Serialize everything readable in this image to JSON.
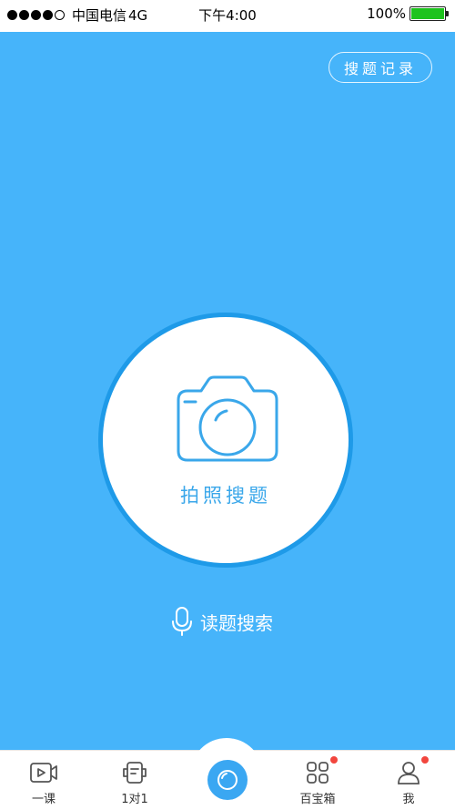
{
  "status_bar": {
    "carrier": "中国电信",
    "network": "4G",
    "time": "下午4:00",
    "battery": "100%",
    "battery_color": "#1ec31e"
  },
  "header": {
    "history_label": "搜题记录"
  },
  "capture": {
    "label": "拍照搜题",
    "icon": "camera-icon"
  },
  "voice": {
    "label": "读题搜索",
    "icon": "microphone-icon"
  },
  "tabs": [
    {
      "label": "一课",
      "icon": "video-lesson-icon",
      "badge": false
    },
    {
      "label": "1对1",
      "icon": "tutor-icon",
      "badge": false
    },
    {
      "label": "",
      "icon": "camera-shutter-icon",
      "badge": false
    },
    {
      "label": "百宝箱",
      "icon": "grid-icon",
      "badge": true
    },
    {
      "label": "我",
      "icon": "user-icon",
      "badge": true
    }
  ],
  "colors": {
    "primary_blue": "#46b4fa",
    "accent_blue": "#3aa7ea",
    "badge_red": "#f2453d"
  }
}
